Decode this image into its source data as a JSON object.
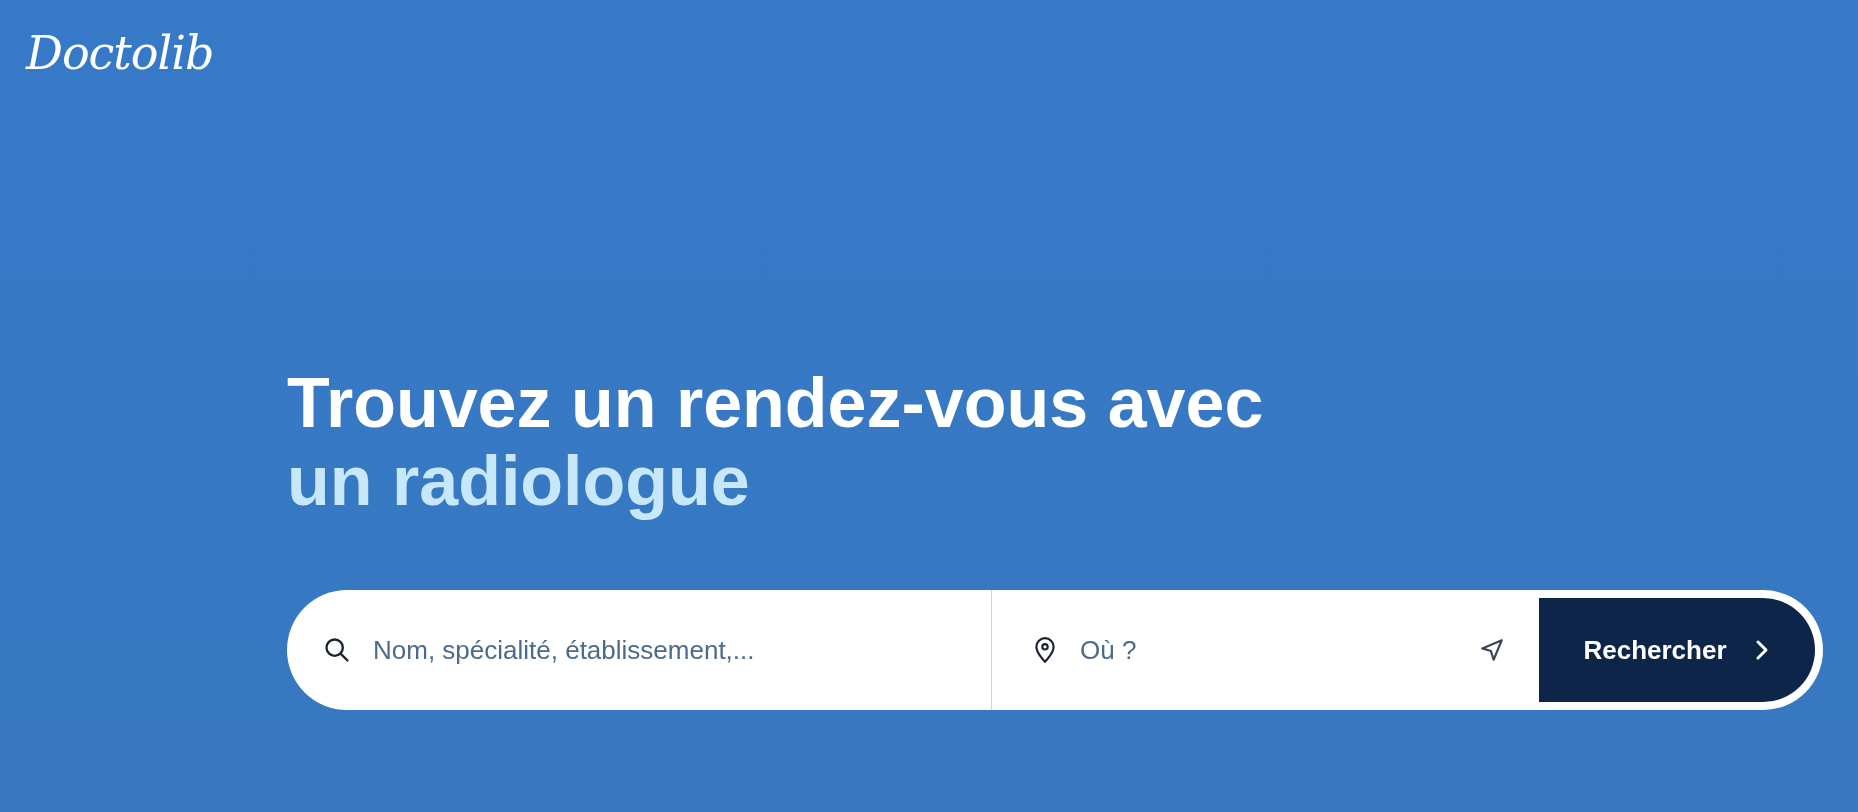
{
  "logo": "Doctolib",
  "headline": {
    "line_1": "Trouvez un rendez-vous avec",
    "line_2": "un radiologue"
  },
  "search": {
    "query_placeholder": "Nom, spécialité, établissement,...",
    "location_placeholder": "Où ?",
    "button_label": "Rechercher"
  }
}
